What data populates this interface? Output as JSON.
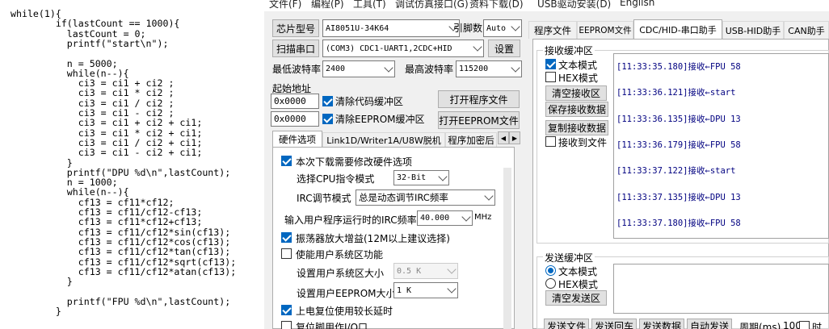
{
  "editor": {
    "lines": [
      "while(1){",
      "        if(lastCount == 1000){",
      "          lastCount = 0;",
      "          printf(\"start\\n\");",
      "",
      "          n = 5000;",
      "          while(n--){",
      "            ci3 = ci1 + ci2 ;",
      "            ci3 = ci1 * ci2 ;",
      "            ci3 = ci1 / ci2 ;",
      "            ci3 = ci1 - ci2 ;",
      "            ci3 = ci1 + ci2 + ci1;",
      "            ci3 = ci1 * ci2 + ci1;",
      "            ci3 = ci1 / ci2 + ci1;",
      "            ci3 = ci1 - ci2 + ci1;",
      "          }",
      "          printf(\"DPU %d\\n\",lastCount);",
      "          n = 1000;",
      "          while(n--){",
      "            cf13 = cf11*cf12;",
      "            cf13 = cf11/cf12-cf13;",
      "            cf13 = cf11*cf12+cf13;",
      "            cf13 = cf11/cf12*sin(cf13);",
      "            cf13 = cf11/cf12*cos(cf13);",
      "            cf13 = cf11/cf12*tan(cf13);",
      "            cf13 = cf11/cf12*sqrt(cf13);",
      "            cf13 = cf11/cf12*atan(cf13);",
      "          }",
      "",
      "          printf(\"FPU %d\\n\",lastCount);",
      "        }"
    ]
  },
  "menu": [
    "文件(F)",
    "编程(P)",
    "工具(T)",
    "调试仿真接口(G)",
    "资料下载(D)",
    "USB驱动安装(D)",
    "English"
  ],
  "chip": {
    "label": "芯片型号",
    "value": "AI8051U-34K64",
    "pins_label": "引脚数",
    "pins_value": "Auto"
  },
  "port": {
    "scan_label": "扫描串口",
    "value": "(COM3) CDC1-UART1,2CDC+HID",
    "settings_label": "设置"
  },
  "baud": {
    "min_label": "最低波特率",
    "min_value": "2400",
    "max_label": "最高波特率",
    "max_value": "115200"
  },
  "start_addr": {
    "label": "起始地址",
    "code_value": "0x0000",
    "clear_code": "清除代码缓冲区",
    "eeprom_value": "0x0000",
    "clear_eeprom": "清除EEPROM缓冲区",
    "open_program": "打开程序文件",
    "open_eeprom": "打开EEPROM文件"
  },
  "hw_tabs": [
    "硬件选项",
    "Link1D/Writer1A/U8W脱机",
    "程序加密后"
  ],
  "hw": {
    "need_hw": "本次下载需要修改硬件选项",
    "cpu_label": "选择CPU指令模式",
    "cpu_value": "32-Bit",
    "irc_label": "IRC调节模式",
    "irc_value": "总是动态调节IRC频率",
    "freq_label": "输入用户程序运行时的IRC频率",
    "freq_value": "40.000",
    "freq_unit": "MHz",
    "osc_gain": "振荡器放大增益(12M以上建议选择)",
    "user_sys": "使能用户系统区功能",
    "sys_size_label": "设置用户系统区大小",
    "sys_size_value": "0.5 K",
    "eeprom_size_label": "设置用户EEPROM大小",
    "eeprom_size_value": "1   K",
    "power_delay": "上电复位使用较长延时",
    "reset_pin": "复位脚用作I/O口"
  },
  "right_tabs": [
    "程序文件",
    "EEPROM文件",
    "CDC/HID-串口助手",
    "USB-HID助手",
    "CAN助手"
  ],
  "recv": {
    "title": "接收缓冲区",
    "text_mode": "文本模式",
    "hex_mode": "HEX模式",
    "clear": "清空接收区",
    "save": "保存接收数据",
    "copy": "复制接收数据",
    "to_file": "接收到文件",
    "lines": [
      "[11:33:35.180]接收←FPU 58",
      "[11:33:36.121]接收←start",
      "[11:33:36.135]接收←DPU 13",
      "[11:33:36.179]接收←FPU 58",
      "[11:33:37.122]接收←start",
      "[11:33:37.135]接收←DPU 13",
      "[11:33:37.180]接收←FPU 58"
    ]
  },
  "send": {
    "title": "发送缓冲区",
    "text_mode": "文本模式",
    "hex_mode": "HEX模式",
    "clear": "清空发送区",
    "bottom": [
      "发送文件",
      "发送回车",
      "发送数据",
      "自动发送",
      "周期(ms)",
      "100",
      "时"
    ]
  }
}
